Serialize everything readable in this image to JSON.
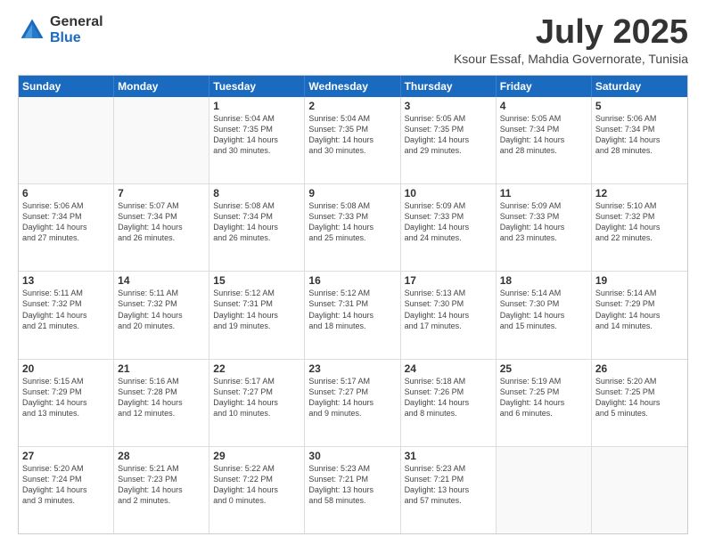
{
  "logo": {
    "general": "General",
    "blue": "Blue"
  },
  "title": "July 2025",
  "subtitle": "Ksour Essaf, Mahdia Governorate, Tunisia",
  "header_days": [
    "Sunday",
    "Monday",
    "Tuesday",
    "Wednesday",
    "Thursday",
    "Friday",
    "Saturday"
  ],
  "weeks": [
    [
      {
        "day": "",
        "info": ""
      },
      {
        "day": "",
        "info": ""
      },
      {
        "day": "1",
        "info": "Sunrise: 5:04 AM\nSunset: 7:35 PM\nDaylight: 14 hours\nand 30 minutes."
      },
      {
        "day": "2",
        "info": "Sunrise: 5:04 AM\nSunset: 7:35 PM\nDaylight: 14 hours\nand 30 minutes."
      },
      {
        "day": "3",
        "info": "Sunrise: 5:05 AM\nSunset: 7:35 PM\nDaylight: 14 hours\nand 29 minutes."
      },
      {
        "day": "4",
        "info": "Sunrise: 5:05 AM\nSunset: 7:34 PM\nDaylight: 14 hours\nand 28 minutes."
      },
      {
        "day": "5",
        "info": "Sunrise: 5:06 AM\nSunset: 7:34 PM\nDaylight: 14 hours\nand 28 minutes."
      }
    ],
    [
      {
        "day": "6",
        "info": "Sunrise: 5:06 AM\nSunset: 7:34 PM\nDaylight: 14 hours\nand 27 minutes."
      },
      {
        "day": "7",
        "info": "Sunrise: 5:07 AM\nSunset: 7:34 PM\nDaylight: 14 hours\nand 26 minutes."
      },
      {
        "day": "8",
        "info": "Sunrise: 5:08 AM\nSunset: 7:34 PM\nDaylight: 14 hours\nand 26 minutes."
      },
      {
        "day": "9",
        "info": "Sunrise: 5:08 AM\nSunset: 7:33 PM\nDaylight: 14 hours\nand 25 minutes."
      },
      {
        "day": "10",
        "info": "Sunrise: 5:09 AM\nSunset: 7:33 PM\nDaylight: 14 hours\nand 24 minutes."
      },
      {
        "day": "11",
        "info": "Sunrise: 5:09 AM\nSunset: 7:33 PM\nDaylight: 14 hours\nand 23 minutes."
      },
      {
        "day": "12",
        "info": "Sunrise: 5:10 AM\nSunset: 7:32 PM\nDaylight: 14 hours\nand 22 minutes."
      }
    ],
    [
      {
        "day": "13",
        "info": "Sunrise: 5:11 AM\nSunset: 7:32 PM\nDaylight: 14 hours\nand 21 minutes."
      },
      {
        "day": "14",
        "info": "Sunrise: 5:11 AM\nSunset: 7:32 PM\nDaylight: 14 hours\nand 20 minutes."
      },
      {
        "day": "15",
        "info": "Sunrise: 5:12 AM\nSunset: 7:31 PM\nDaylight: 14 hours\nand 19 minutes."
      },
      {
        "day": "16",
        "info": "Sunrise: 5:12 AM\nSunset: 7:31 PM\nDaylight: 14 hours\nand 18 minutes."
      },
      {
        "day": "17",
        "info": "Sunrise: 5:13 AM\nSunset: 7:30 PM\nDaylight: 14 hours\nand 17 minutes."
      },
      {
        "day": "18",
        "info": "Sunrise: 5:14 AM\nSunset: 7:30 PM\nDaylight: 14 hours\nand 15 minutes."
      },
      {
        "day": "19",
        "info": "Sunrise: 5:14 AM\nSunset: 7:29 PM\nDaylight: 14 hours\nand 14 minutes."
      }
    ],
    [
      {
        "day": "20",
        "info": "Sunrise: 5:15 AM\nSunset: 7:29 PM\nDaylight: 14 hours\nand 13 minutes."
      },
      {
        "day": "21",
        "info": "Sunrise: 5:16 AM\nSunset: 7:28 PM\nDaylight: 14 hours\nand 12 minutes."
      },
      {
        "day": "22",
        "info": "Sunrise: 5:17 AM\nSunset: 7:27 PM\nDaylight: 14 hours\nand 10 minutes."
      },
      {
        "day": "23",
        "info": "Sunrise: 5:17 AM\nSunset: 7:27 PM\nDaylight: 14 hours\nand 9 minutes."
      },
      {
        "day": "24",
        "info": "Sunrise: 5:18 AM\nSunset: 7:26 PM\nDaylight: 14 hours\nand 8 minutes."
      },
      {
        "day": "25",
        "info": "Sunrise: 5:19 AM\nSunset: 7:25 PM\nDaylight: 14 hours\nand 6 minutes."
      },
      {
        "day": "26",
        "info": "Sunrise: 5:20 AM\nSunset: 7:25 PM\nDaylight: 14 hours\nand 5 minutes."
      }
    ],
    [
      {
        "day": "27",
        "info": "Sunrise: 5:20 AM\nSunset: 7:24 PM\nDaylight: 14 hours\nand 3 minutes."
      },
      {
        "day": "28",
        "info": "Sunrise: 5:21 AM\nSunset: 7:23 PM\nDaylight: 14 hours\nand 2 minutes."
      },
      {
        "day": "29",
        "info": "Sunrise: 5:22 AM\nSunset: 7:22 PM\nDaylight: 14 hours\nand 0 minutes."
      },
      {
        "day": "30",
        "info": "Sunrise: 5:23 AM\nSunset: 7:21 PM\nDaylight: 13 hours\nand 58 minutes."
      },
      {
        "day": "31",
        "info": "Sunrise: 5:23 AM\nSunset: 7:21 PM\nDaylight: 13 hours\nand 57 minutes."
      },
      {
        "day": "",
        "info": ""
      },
      {
        "day": "",
        "info": ""
      }
    ]
  ]
}
